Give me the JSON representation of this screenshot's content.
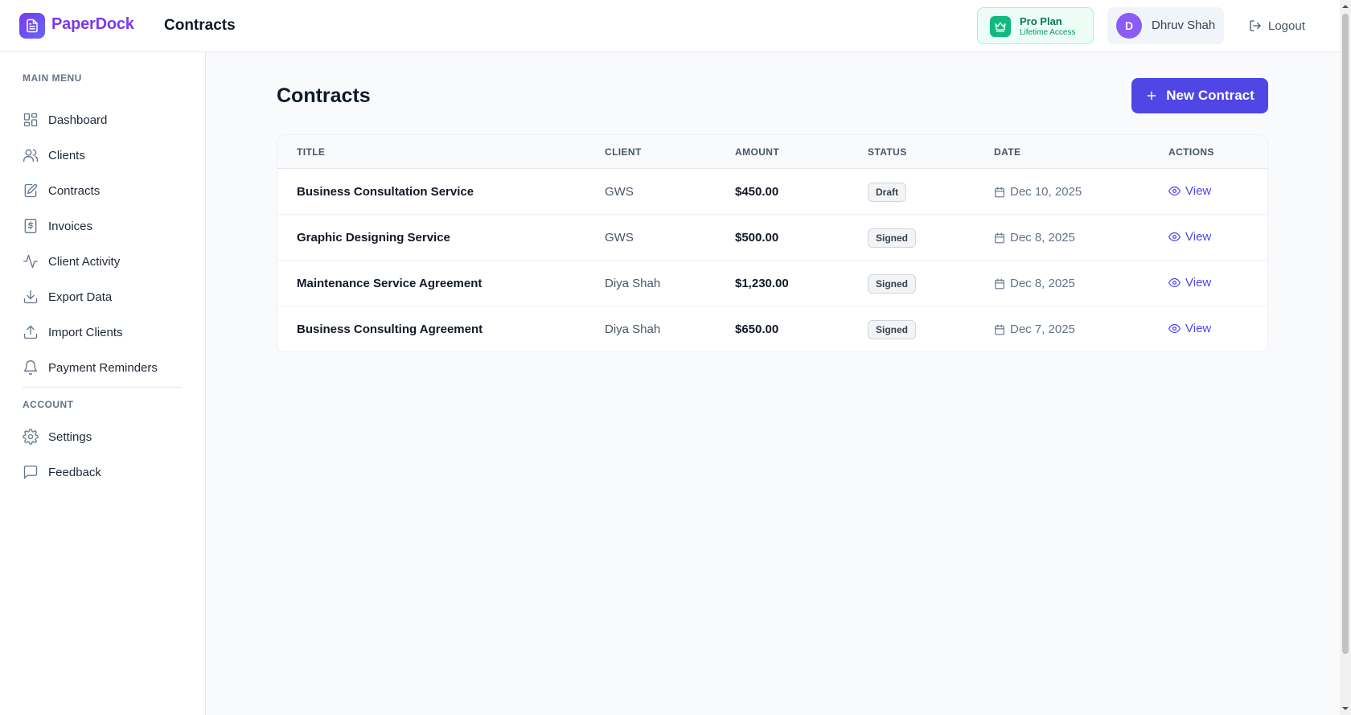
{
  "header": {
    "brand": "PaperDock",
    "title": "Contracts",
    "plan": {
      "name": "Pro Plan",
      "subtitle": "Lifetime Access"
    },
    "user": {
      "initial": "D",
      "name": "Dhruv Shah"
    },
    "logout_label": "Logout"
  },
  "sidebar": {
    "main_label": "MAIN MENU",
    "items": [
      {
        "label": "Dashboard",
        "icon": "dashboard-icon"
      },
      {
        "label": "Clients",
        "icon": "users-icon"
      },
      {
        "label": "Contracts",
        "icon": "edit-document-icon"
      },
      {
        "label": "Invoices",
        "icon": "dollar-document-icon"
      },
      {
        "label": "Client Activity",
        "icon": "activity-icon"
      },
      {
        "label": "Export Data",
        "icon": "download-icon"
      },
      {
        "label": "Import Clients",
        "icon": "upload-icon"
      },
      {
        "label": "Payment Reminders",
        "icon": "bell-icon"
      }
    ],
    "account_label": "ACCOUNT",
    "account_items": [
      {
        "label": "Settings",
        "icon": "gear-icon"
      },
      {
        "label": "Feedback",
        "icon": "chat-icon"
      }
    ]
  },
  "main": {
    "title": "Contracts",
    "new_button": "New Contract",
    "table": {
      "columns": [
        "TITLE",
        "CLIENT",
        "AMOUNT",
        "STATUS",
        "DATE",
        "ACTIONS"
      ],
      "rows": [
        {
          "title": "Business Consultation Service",
          "client": "GWS",
          "amount": "$450.00",
          "status": "Draft",
          "date": "Dec 10, 2025",
          "action": "View"
        },
        {
          "title": "Graphic Designing Service",
          "client": "GWS",
          "amount": "$500.00",
          "status": "Signed",
          "date": "Dec 8, 2025",
          "action": "View"
        },
        {
          "title": "Maintenance Service Agreement",
          "client": "Diya Shah",
          "amount": "$1,230.00",
          "status": "Signed",
          "date": "Dec 8, 2025",
          "action": "View"
        },
        {
          "title": "Business Consulting Agreement",
          "client": "Diya Shah",
          "amount": "$650.00",
          "status": "Signed",
          "date": "Dec 7, 2025",
          "action": "View"
        }
      ]
    }
  },
  "colors": {
    "accent": "#4f46e5",
    "brand": "#7c3aed",
    "plan_green": "#10b981"
  }
}
